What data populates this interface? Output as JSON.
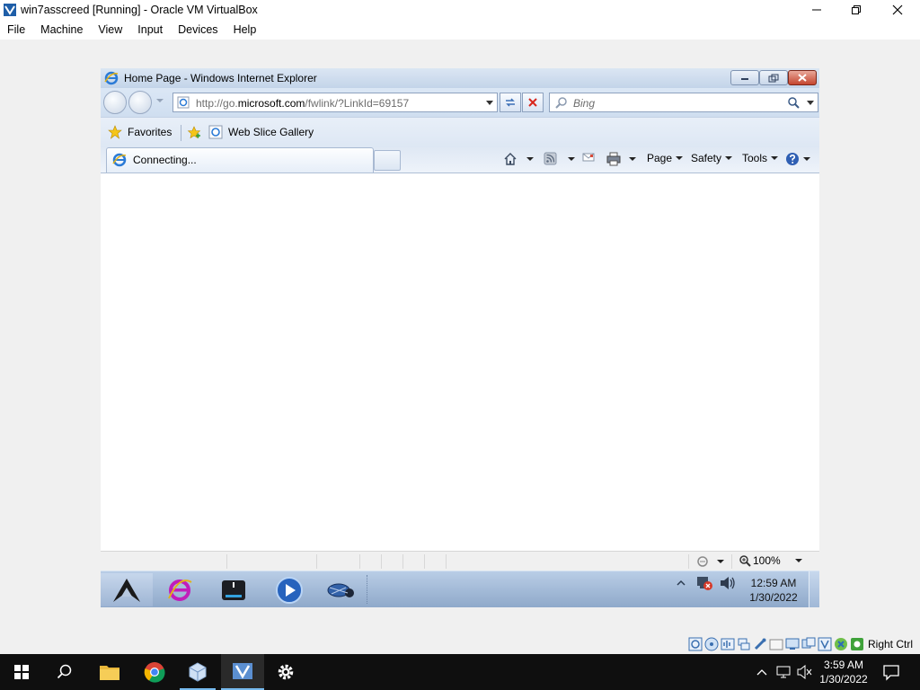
{
  "vbox": {
    "title": "win7asscreed [Running] - Oracle VM VirtualBox",
    "menu": [
      "File",
      "Machine",
      "View",
      "Input",
      "Devices",
      "Help"
    ],
    "host_key": "Right Ctrl"
  },
  "ie": {
    "title": "Home Page - Windows Internet Explorer",
    "url_prefix": "http://go.",
    "url_domain": "microsoft.com",
    "url_path": "/fwlink/?LinkId=69157",
    "search_placeholder": "Bing",
    "favorites_label": "Favorites",
    "web_slice_label": "Web Slice Gallery",
    "tab_title": "Connecting...",
    "cmd_page": "Page",
    "cmd_safety": "Safety",
    "cmd_tools": "Tools",
    "zoom": "100%"
  },
  "guest_taskbar": {
    "time": "12:59 AM",
    "date": "1/30/2022"
  },
  "host_taskbar": {
    "time": "3:59 AM",
    "date": "1/30/2022"
  },
  "colors": {
    "ie_frame": "#cfdef0",
    "guest_taskbar": "#9fb7d6",
    "host_taskbar": "#0f0f0f",
    "accent": "#76b9ed"
  }
}
